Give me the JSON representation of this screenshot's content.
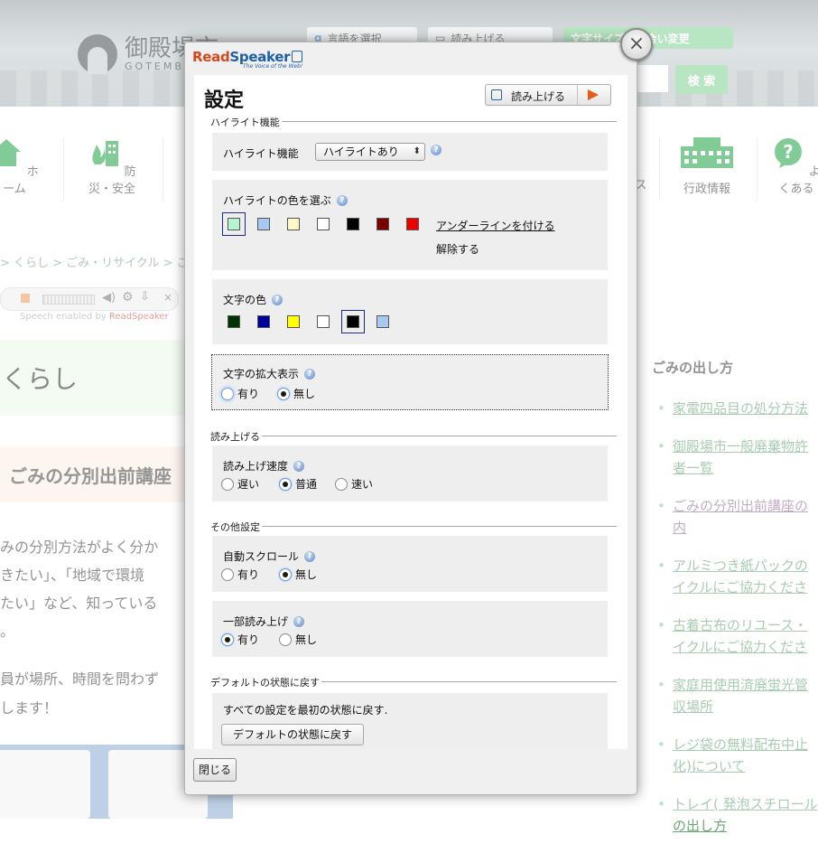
{
  "site": {
    "logo_text": "御殿場市",
    "logo_sub": "GOTEMBA",
    "lang_select": "言語を選択",
    "read_aloud": "読み上げる",
    "text_color_change": "文字サイズ・色合い変更",
    "search_button": "検 索",
    "nav": [
      "ホーム",
      "防災・安全",
      "ス",
      "行政情報",
      "よくある"
    ],
    "breadcrumb": "> くらし > ごみ・リサイクル > ごみ",
    "speech_enabled": "Speech enabled by",
    "speech_brand": "ReadSpeaker",
    "section_title": "くらし",
    "article_title": "ごみの分別出前講座",
    "body_lines": [
      "みの分別方法がよく分か",
      "きたい」、「地域で環境",
      "たい」など、知っている",
      "。"
    ],
    "body_lines2": [
      "員が場所、時間を問わず",
      "します！"
    ],
    "side_title": "ごみの出し方",
    "side_links": [
      "家電四品目の処分方法",
      "御殿場市一般廃棄物許\n者一覧",
      "ごみの分別出前講座の\n内",
      "アルミつき紙パックの\nイクルにご協力くださ",
      "古着古布のリユース・\nイクルにご協力くださ",
      "家庭用使用済廃蛍光管\n収場所",
      "レジ袋の無料配布中止\n化)について",
      "トレイ( 発泡スチロール\nの出し方"
    ]
  },
  "dialog": {
    "brand_read": "Read",
    "brand_speaker": "Speaker",
    "tagline": "The Voice of the Web!",
    "close_x": "×",
    "title": "設定",
    "read_button": "読み上げる",
    "sections": {
      "highlight": "ハイライト機能",
      "reading": "読み上げる",
      "other": "その他設定",
      "default": "デフォルトの状態に戻す"
    },
    "highlight_label": "ハイライト機能",
    "highlight_select": "ハイライトあり",
    "highlight_color_label": "ハイライトの色を選ぶ",
    "highlight_colors": [
      "#b7f5cf",
      "#a9c8f2",
      "#fff9c8",
      "#ffffff",
      "#000000",
      "#7a0000",
      "#ee0000"
    ],
    "underline_link": "アンダーラインを付ける",
    "remove_link": "解除する",
    "text_color_label": "文字の色",
    "text_colors": [
      "#003300",
      "#000099",
      "#ffff00",
      "#ffffff",
      "#000000",
      "#a9c8f2"
    ],
    "zoom_label": "文字の拡大表示",
    "zoom_options": [
      "有り",
      "無し"
    ],
    "speed_label": "読み上げ速度",
    "speed_options": [
      "遅い",
      "普通",
      "速い"
    ],
    "autoscroll_label": "自動スクロール",
    "autoscroll_options": [
      "有り",
      "無し"
    ],
    "partial_label": "一部読み上げ",
    "partial_options": [
      "有り",
      "無し"
    ],
    "reset_text": "すべての設定を最初の状態に戻す.",
    "reset_button": "デフォルトの状態に戻す",
    "close_button": "閉じる"
  }
}
